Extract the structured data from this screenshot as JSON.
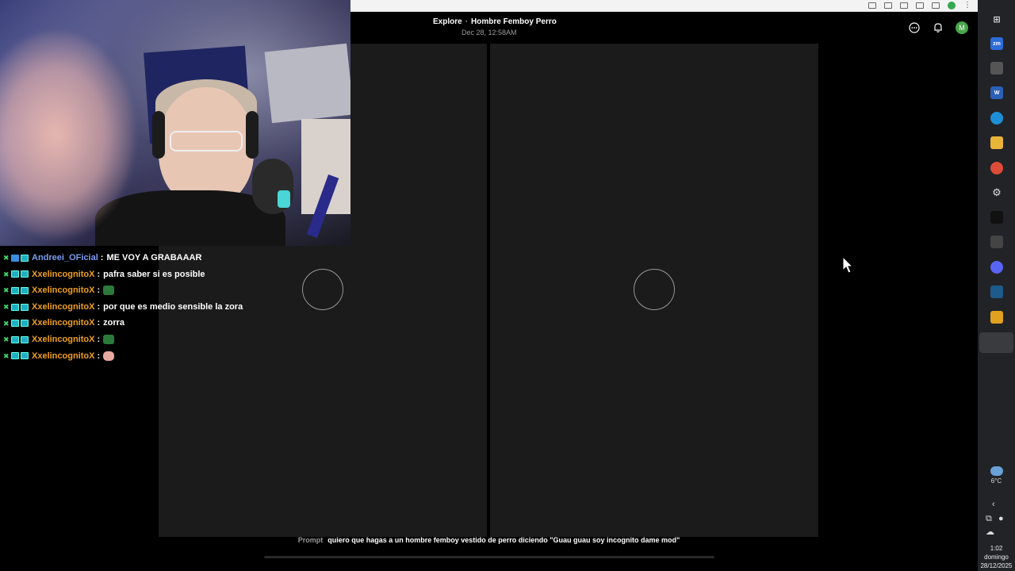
{
  "browser": {
    "explore_link": "Explore",
    "separator": "·",
    "title": "Hombre Femboy Perro",
    "date": "Dec 28, 12:58AM",
    "avatar_initial": "M"
  },
  "prompt": {
    "label": "Prompt",
    "text": "quiero que hagas a un hombre femboy vestido de perro diciendo \"Guau guau soy incognito dame mod\""
  },
  "chat": {
    "messages": [
      {
        "user": "Andreei_OFicial",
        "text": "ME VOY A GRABAAAR"
      },
      {
        "user": "XxelincognitoX",
        "text": "pafra saber si es posible"
      },
      {
        "user": "XxelincognitoX",
        "text": "",
        "emote": "turtle-emote"
      },
      {
        "user": "XxelincognitoX",
        "text": "por que es medio sensible la zora"
      },
      {
        "user": "XxelincognitoX",
        "text": "zorra"
      },
      {
        "user": "XxelincognitoX",
        "text": "",
        "emote": "turtle-emote"
      },
      {
        "user": "XxelincognitoX",
        "text": "",
        "emote": "hand-emote"
      }
    ],
    "separator": ":"
  },
  "taskbar": {
    "apps": [
      "task-view-icon",
      "zoom-icon",
      "app-icon",
      "word-icon",
      "edge-icon",
      "file-explorer-icon",
      "chrome-icon",
      "settings-icon",
      "capcut-icon",
      "app-icon",
      "discord-icon",
      "app-icon",
      "app-icon",
      "chrome-profile-icon"
    ],
    "zoom_label": "zm",
    "word_label": "W",
    "weather_temp": "6°C",
    "time": "1:02",
    "day": "domingo",
    "date": "28/12/2025"
  },
  "colors": {
    "username_primary": "#7b9cf0",
    "username_secondary": "#f0a020",
    "panel_bg": "#1b1b1b",
    "taskbar_bg": "#222326"
  }
}
